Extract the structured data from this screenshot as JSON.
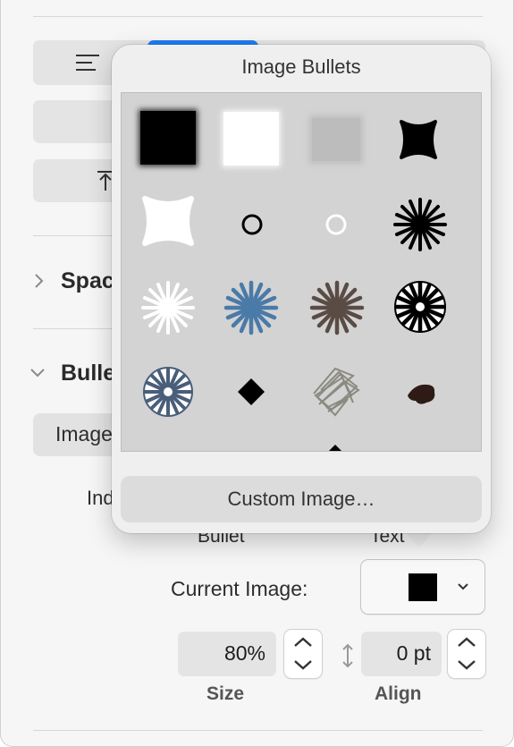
{
  "sections": {
    "spacing": "Spacing",
    "bullets": "Bullets"
  },
  "bullets_panel": {
    "style_value": "Image Bullets",
    "indent_label": "Indent:",
    "bullet_label": "Bullet",
    "text_label": "Text",
    "current_image_label": "Current Image:",
    "current_image_chevron": "chevron-down-icon",
    "size_value": "80%",
    "size_label": "Size",
    "align_value": "0 pt",
    "align_label": "Align"
  },
  "popover": {
    "title": "Image Bullets",
    "custom_image_label": "Custom Image…",
    "bullets": [
      "black-square-bullet",
      "white-square-bullet",
      "gray-square-bullet",
      "black-rounded-star-bullet",
      "white-rounded-star-bullet",
      "black-circle-outline-bullet",
      "white-circle-outline-bullet",
      "black-starburst-bullet",
      "white-starburst-bullet",
      "blue-starburst-bullet",
      "brown-starburst-bullet",
      "black-white-starburst-bullet",
      "blue-white-starburst-bullet",
      "black-diamond-bullet",
      "scribble-diamond-bullet",
      "dark-brown-blob-bullet"
    ]
  },
  "colors": {
    "selected_accent": "#1e7cf2"
  }
}
